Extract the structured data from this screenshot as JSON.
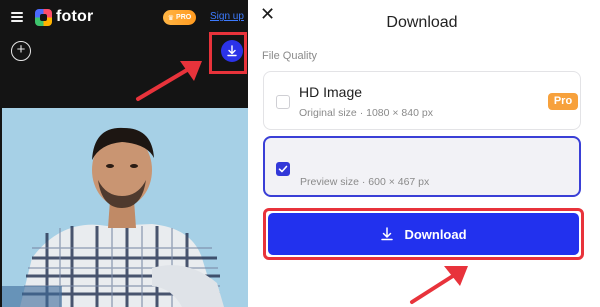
{
  "editor": {
    "brand": "fotor",
    "pro_label": "PRO",
    "signup_label": "Sign up",
    "add_label": "+"
  },
  "dialog": {
    "close_label": "✕",
    "title": "Download",
    "section_label": "File Quality",
    "options": [
      {
        "name": "HD Image",
        "description": "Original size · 1080 × 840 px",
        "badge": "Pro",
        "checked": false
      },
      {
        "name": "",
        "description": "Preview size · 600 × 467 px",
        "checked": true
      }
    ],
    "download_label": "Download"
  },
  "colors": {
    "accent_blue": "#2231ee",
    "highlight_red": "#e8333b",
    "pro_orange": "#f7a13c",
    "editor_bg": "#141414"
  },
  "icons": [
    "menu-icon",
    "fotor-logo-icon",
    "crown-icon",
    "plus-icon",
    "download-icon",
    "check-icon",
    "close-icon"
  ]
}
